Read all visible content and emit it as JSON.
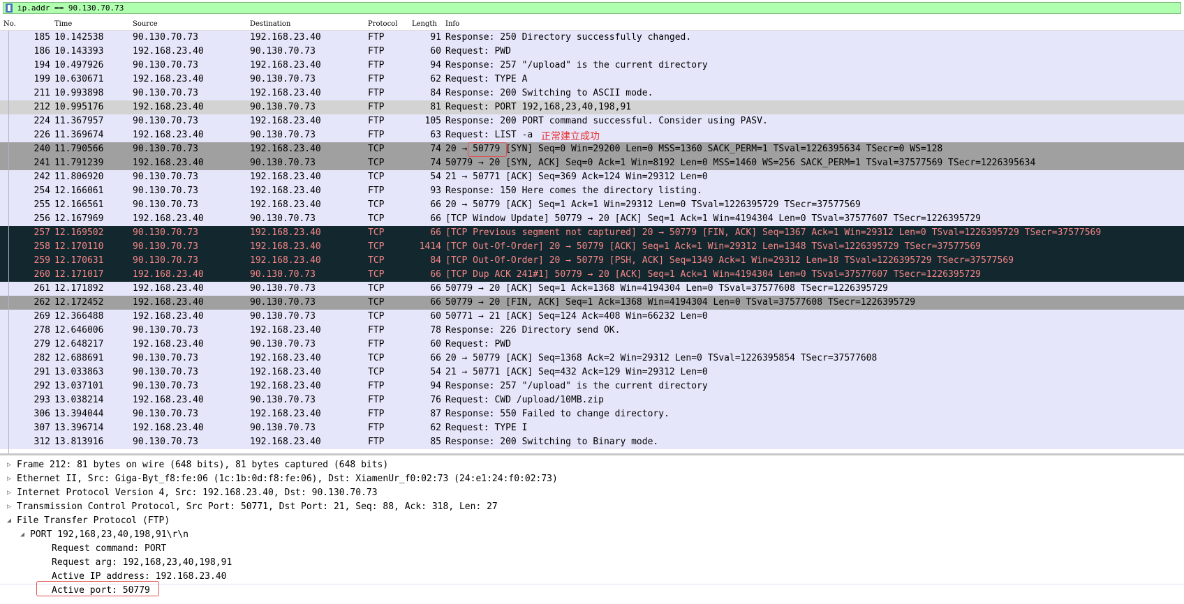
{
  "filter": {
    "value": "ip.addr == 90.130.70.73"
  },
  "columns": [
    "No.",
    "Time",
    "Source",
    "Destination",
    "Protocol",
    "Length",
    "Info"
  ],
  "colors": {
    "ftp_bg": "#e6e6fa",
    "selected_bg": "#d3d3d3",
    "syn_bg": "#a0a0a0",
    "error_bg": "#12272e",
    "error_fg": "#f78787",
    "annotation": "#e83030"
  },
  "packets": [
    {
      "no": "185",
      "time": "10.142538",
      "src": "90.130.70.73",
      "dst": "192.168.23.40",
      "proto": "FTP",
      "len": "91",
      "info": "Response: 250 Directory successfully changed.",
      "style": "ftp"
    },
    {
      "no": "186",
      "time": "10.143393",
      "src": "192.168.23.40",
      "dst": "90.130.70.73",
      "proto": "FTP",
      "len": "60",
      "info": "Request: PWD",
      "style": "ftp"
    },
    {
      "no": "194",
      "time": "10.497926",
      "src": "90.130.70.73",
      "dst": "192.168.23.40",
      "proto": "FTP",
      "len": "94",
      "info": "Response: 257 \"/upload\" is the current directory",
      "style": "ftp"
    },
    {
      "no": "199",
      "time": "10.630671",
      "src": "192.168.23.40",
      "dst": "90.130.70.73",
      "proto": "FTP",
      "len": "62",
      "info": "Request: TYPE A",
      "style": "ftp"
    },
    {
      "no": "211",
      "time": "10.993898",
      "src": "90.130.70.73",
      "dst": "192.168.23.40",
      "proto": "FTP",
      "len": "84",
      "info": "Response: 200 Switching to ASCII mode.",
      "style": "ftp"
    },
    {
      "no": "212",
      "time": "10.995176",
      "src": "192.168.23.40",
      "dst": "90.130.70.73",
      "proto": "FTP",
      "len": "81",
      "info": "Request: PORT 192,168,23,40,198,91",
      "style": "sel"
    },
    {
      "no": "224",
      "time": "11.367957",
      "src": "90.130.70.73",
      "dst": "192.168.23.40",
      "proto": "FTP",
      "len": "105",
      "info": "Response: 200 PORT command successful. Consider using PASV.",
      "style": "ftp"
    },
    {
      "no": "226",
      "time": "11.369674",
      "src": "192.168.23.40",
      "dst": "90.130.70.73",
      "proto": "FTP",
      "len": "63",
      "info": "Request: LIST -a",
      "style": "ftp"
    },
    {
      "no": "240",
      "time": "11.790566",
      "src": "90.130.70.73",
      "dst": "192.168.23.40",
      "proto": "TCP",
      "len": "74",
      "info": "20 → 50779 [SYN] Seq=0 Win=29200 Len=0 MSS=1360 SACK_PERM=1 TSval=1226395634 TSecr=0 WS=128",
      "style": "syn"
    },
    {
      "no": "241",
      "time": "11.791239",
      "src": "192.168.23.40",
      "dst": "90.130.70.73",
      "proto": "TCP",
      "len": "74",
      "info": "50779 → 20 [SYN, ACK] Seq=0 Ack=1 Win=8192 Len=0 MSS=1460 WS=256 SACK_PERM=1 TSval=37577569 TSecr=1226395634",
      "style": "syn"
    },
    {
      "no": "242",
      "time": "11.806920",
      "src": "90.130.70.73",
      "dst": "192.168.23.40",
      "proto": "TCP",
      "len": "54",
      "info": "21 → 50771 [ACK] Seq=369 Ack=124 Win=29312 Len=0",
      "style": "tcp"
    },
    {
      "no": "254",
      "time": "12.166061",
      "src": "90.130.70.73",
      "dst": "192.168.23.40",
      "proto": "FTP",
      "len": "93",
      "info": "Response: 150 Here comes the directory listing.",
      "style": "ftp"
    },
    {
      "no": "255",
      "time": "12.166561",
      "src": "90.130.70.73",
      "dst": "192.168.23.40",
      "proto": "TCP",
      "len": "66",
      "info": "20 → 50779 [ACK] Seq=1 Ack=1 Win=29312 Len=0 TSval=1226395729 TSecr=37577569",
      "style": "tcp"
    },
    {
      "no": "256",
      "time": "12.167969",
      "src": "192.168.23.40",
      "dst": "90.130.70.73",
      "proto": "TCP",
      "len": "66",
      "info": "[TCP Window Update] 50779 → 20 [ACK] Seq=1 Ack=1 Win=4194304 Len=0 TSval=37577607 TSecr=1226395729",
      "style": "tcp"
    },
    {
      "no": "257",
      "time": "12.169502",
      "src": "90.130.70.73",
      "dst": "192.168.23.40",
      "proto": "TCP",
      "len": "66",
      "info": "[TCP Previous segment not captured] 20 → 50779 [FIN, ACK] Seq=1367 Ack=1 Win=29312 Len=0 TSval=1226395729 TSecr=37577569",
      "style": "err"
    },
    {
      "no": "258",
      "time": "12.170110",
      "src": "90.130.70.73",
      "dst": "192.168.23.40",
      "proto": "TCP",
      "len": "1414",
      "info": "[TCP Out-Of-Order] 20 → 50779 [ACK] Seq=1 Ack=1 Win=29312 Len=1348 TSval=1226395729 TSecr=37577569",
      "style": "err"
    },
    {
      "no": "259",
      "time": "12.170631",
      "src": "90.130.70.73",
      "dst": "192.168.23.40",
      "proto": "TCP",
      "len": "84",
      "info": "[TCP Out-Of-Order] 20 → 50779 [PSH, ACK] Seq=1349 Ack=1 Win=29312 Len=18 TSval=1226395729 TSecr=37577569",
      "style": "err"
    },
    {
      "no": "260",
      "time": "12.171017",
      "src": "192.168.23.40",
      "dst": "90.130.70.73",
      "proto": "TCP",
      "len": "66",
      "info": "[TCP Dup ACK 241#1] 50779 → 20 [ACK] Seq=1 Ack=1 Win=4194304 Len=0 TSval=37577607 TSecr=1226395729",
      "style": "err"
    },
    {
      "no": "261",
      "time": "12.171892",
      "src": "192.168.23.40",
      "dst": "90.130.70.73",
      "proto": "TCP",
      "len": "66",
      "info": "50779 → 20 [ACK] Seq=1 Ack=1368 Win=4194304 Len=0 TSval=37577608 TSecr=1226395729",
      "style": "tcp"
    },
    {
      "no": "262",
      "time": "12.172452",
      "src": "192.168.23.40",
      "dst": "90.130.70.73",
      "proto": "TCP",
      "len": "66",
      "info": "50779 → 20 [FIN, ACK] Seq=1 Ack=1368 Win=4194304 Len=0 TSval=37577608 TSecr=1226395729",
      "style": "syn"
    },
    {
      "no": "269",
      "time": "12.366488",
      "src": "192.168.23.40",
      "dst": "90.130.70.73",
      "proto": "TCP",
      "len": "60",
      "info": "50771 → 21 [ACK] Seq=124 Ack=408 Win=66232 Len=0",
      "style": "tcp"
    },
    {
      "no": "278",
      "time": "12.646006",
      "src": "90.130.70.73",
      "dst": "192.168.23.40",
      "proto": "FTP",
      "len": "78",
      "info": "Response: 226 Directory send OK.",
      "style": "ftp"
    },
    {
      "no": "279",
      "time": "12.648217",
      "src": "192.168.23.40",
      "dst": "90.130.70.73",
      "proto": "FTP",
      "len": "60",
      "info": "Request: PWD",
      "style": "ftp"
    },
    {
      "no": "282",
      "time": "12.688691",
      "src": "90.130.70.73",
      "dst": "192.168.23.40",
      "proto": "TCP",
      "len": "66",
      "info": "20 → 50779 [ACK] Seq=1368 Ack=2 Win=29312 Len=0 TSval=1226395854 TSecr=37577608",
      "style": "tcp"
    },
    {
      "no": "291",
      "time": "13.033863",
      "src": "90.130.70.73",
      "dst": "192.168.23.40",
      "proto": "TCP",
      "len": "54",
      "info": "21 → 50771 [ACK] Seq=432 Ack=129 Win=29312 Len=0",
      "style": "tcp"
    },
    {
      "no": "292",
      "time": "13.037101",
      "src": "90.130.70.73",
      "dst": "192.168.23.40",
      "proto": "FTP",
      "len": "94",
      "info": "Response: 257 \"/upload\" is the current directory",
      "style": "ftp"
    },
    {
      "no": "293",
      "time": "13.038214",
      "src": "192.168.23.40",
      "dst": "90.130.70.73",
      "proto": "FTP",
      "len": "76",
      "info": "Request: CWD /upload/10MB.zip",
      "style": "ftp"
    },
    {
      "no": "306",
      "time": "13.394044",
      "src": "90.130.70.73",
      "dst": "192.168.23.40",
      "proto": "FTP",
      "len": "87",
      "info": "Response: 550 Failed to change directory.",
      "style": "ftp"
    },
    {
      "no": "307",
      "time": "13.396714",
      "src": "192.168.23.40",
      "dst": "90.130.70.73",
      "proto": "FTP",
      "len": "62",
      "info": "Request: TYPE I",
      "style": "ftp"
    },
    {
      "no": "312",
      "time": "13.813916",
      "src": "90.130.70.73",
      "dst": "192.168.23.40",
      "proto": "FTP",
      "len": "85",
      "info": "Response: 200 Switching to Binary mode.",
      "style": "ftp"
    }
  ],
  "details": [
    {
      "text": "Frame 212: 81 bytes on wire (648 bits), 81 bytes captured (648 bits)",
      "indent": 0,
      "arrow": "▷",
      "name": "detail-frame"
    },
    {
      "text": "Ethernet II, Src: Giga-Byt_f8:fe:06 (1c:1b:0d:f8:fe:06), Dst: XiamenUr_f0:02:73 (24:e1:24:f0:02:73)",
      "indent": 0,
      "arrow": "▷",
      "name": "detail-ethernet"
    },
    {
      "text": "Internet Protocol Version 4, Src: 192.168.23.40, Dst: 90.130.70.73",
      "indent": 0,
      "arrow": "▷",
      "name": "detail-ipv4"
    },
    {
      "text": "Transmission Control Protocol, Src Port: 50771, Dst Port: 21, Seq: 88, Ack: 318, Len: 27",
      "indent": 0,
      "arrow": "▷",
      "name": "detail-tcp"
    },
    {
      "text": "File Transfer Protocol (FTP)",
      "indent": 0,
      "arrow": "◢",
      "name": "detail-ftp"
    },
    {
      "text": "PORT 192,168,23,40,198,91\\r\\n",
      "indent": 1,
      "arrow": "◢",
      "name": "detail-ftp-port"
    },
    {
      "text": "Request command: PORT",
      "indent": 2,
      "arrow": "",
      "name": "detail-request-command"
    },
    {
      "text": "Request arg: 192,168,23,40,198,91",
      "indent": 2,
      "arrow": "",
      "name": "detail-request-arg"
    },
    {
      "text": "Active IP address: 192.168.23.40",
      "indent": 2,
      "arrow": "",
      "name": "detail-active-ip"
    },
    {
      "text": "Active port: 50779",
      "indent": 2,
      "arrow": "",
      "name": "detail-active-port"
    }
  ],
  "annotation": {
    "text": "正常建立成功"
  }
}
